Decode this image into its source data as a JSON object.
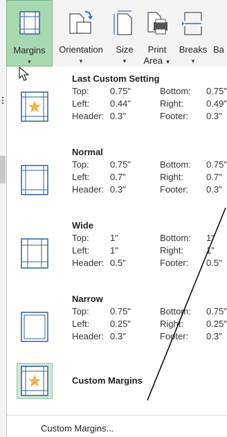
{
  "ribbon": {
    "margins": {
      "label": "Margins"
    },
    "orientation": {
      "label": "Orientation"
    },
    "size": {
      "label": "Size"
    },
    "print_area": {
      "label_line1": "Print",
      "label_line2": "Area"
    },
    "breaks": {
      "label": "Breaks"
    },
    "background": {
      "label": "Ba"
    }
  },
  "margin_presets": [
    {
      "name": "Last Custom Setting",
      "top_label": "Top:",
      "top": "0.75\"",
      "bottom_label": "Bottom:",
      "bottom": "0.75\"",
      "left_label": "Left:",
      "left": "0.44\"",
      "right_label": "Right:",
      "right": "0.49\"",
      "header_label": "Header:",
      "header": "0.3\"",
      "footer_label": "Footer:",
      "footer": "0.3\""
    },
    {
      "name": "Normal",
      "top_label": "Top:",
      "top": "0.75\"",
      "bottom_label": "Bottom:",
      "bottom": "0.75\"",
      "left_label": "Left:",
      "left": "0.7\"",
      "right_label": "Right:",
      "right": "0.7\"",
      "header_label": "Header:",
      "header": "0.3\"",
      "footer_label": "Footer:",
      "footer": "0.3\""
    },
    {
      "name": "Wide",
      "top_label": "Top:",
      "top": "1\"",
      "bottom_label": "Bottom:",
      "bottom": "1\"",
      "left_label": "Left:",
      "left": "1\"",
      "right_label": "Right:",
      "right": "1\"",
      "header_label": "Header:",
      "header": "0.5\"",
      "footer_label": "Footer:",
      "footer": "0.5\""
    },
    {
      "name": "Narrow",
      "top_label": "Top:",
      "top": "0.75\"",
      "bottom_label": "Bottom:",
      "bottom": "0.75\"",
      "left_label": "Left:",
      "left": "0.25\"",
      "right_label": "Right:",
      "right": "0.25\"",
      "header_label": "Header:",
      "header": "0.3\"",
      "footer_label": "Footer:",
      "footer": "0.3\""
    }
  ],
  "custom_margins_item": {
    "label": "Custom Margins"
  },
  "footer_link": {
    "label": "Custom Margins..."
  },
  "colors": {
    "active_tab": "#a8d8b0",
    "star": "#f0b54a",
    "thumb_blue": "#2f5f9e"
  }
}
